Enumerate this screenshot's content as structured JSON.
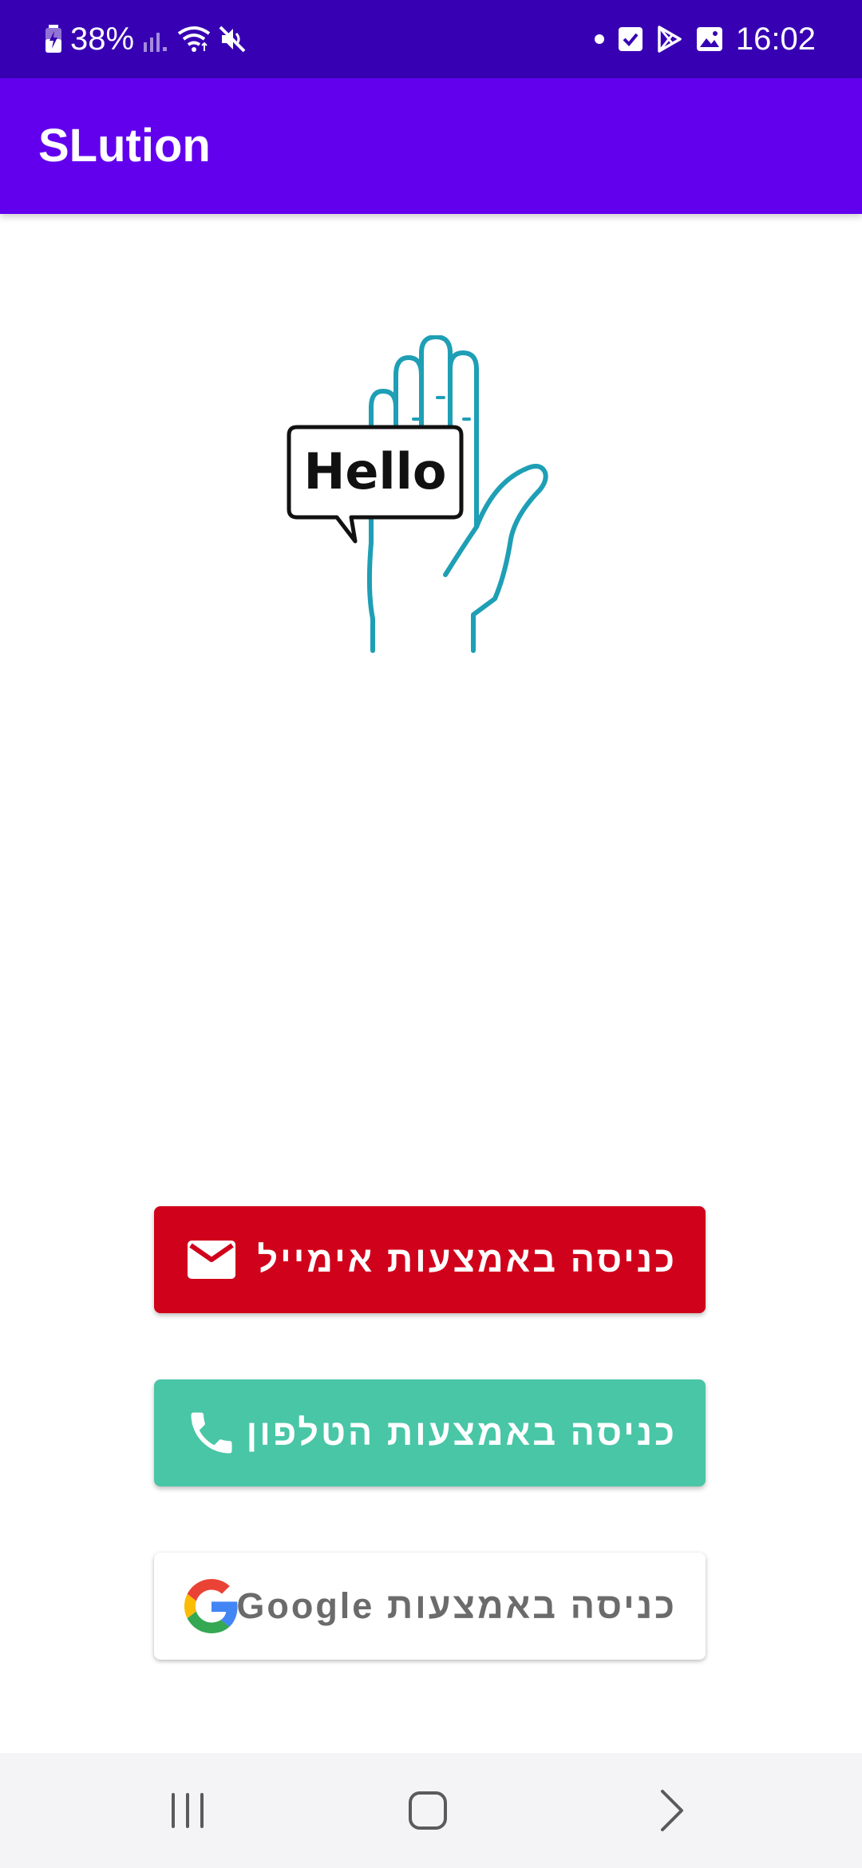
{
  "status_bar": {
    "battery_percent": "38%",
    "time": "16:02",
    "icons": [
      "battery-charging-icon",
      "signal-icon",
      "wifi-icon",
      "mute-icon",
      "notification-dot-icon",
      "checkbox-icon",
      "play-store-icon",
      "gallery-icon"
    ]
  },
  "app_bar": {
    "title": "SLution"
  },
  "logo": {
    "speech_text": "Hello",
    "hand_color": "#1e9fb5"
  },
  "buttons": {
    "email": {
      "label": "כניסה באמצעות אימייל",
      "icon": "mail-icon",
      "color": "#d0011b"
    },
    "phone": {
      "label": "כניסה באמצעות הטלפון",
      "icon": "phone-icon",
      "color": "#48c6a6"
    },
    "google": {
      "label": "כניסה באמצעות Google",
      "icon": "google-icon",
      "color": "#ffffff"
    }
  },
  "nav_bar": {
    "items": [
      "recent-apps-icon",
      "home-icon",
      "back-icon"
    ]
  },
  "colors": {
    "status_bar": "#3700b3",
    "app_bar": "#6200ee",
    "nav_bar": "#f4f4f6"
  }
}
